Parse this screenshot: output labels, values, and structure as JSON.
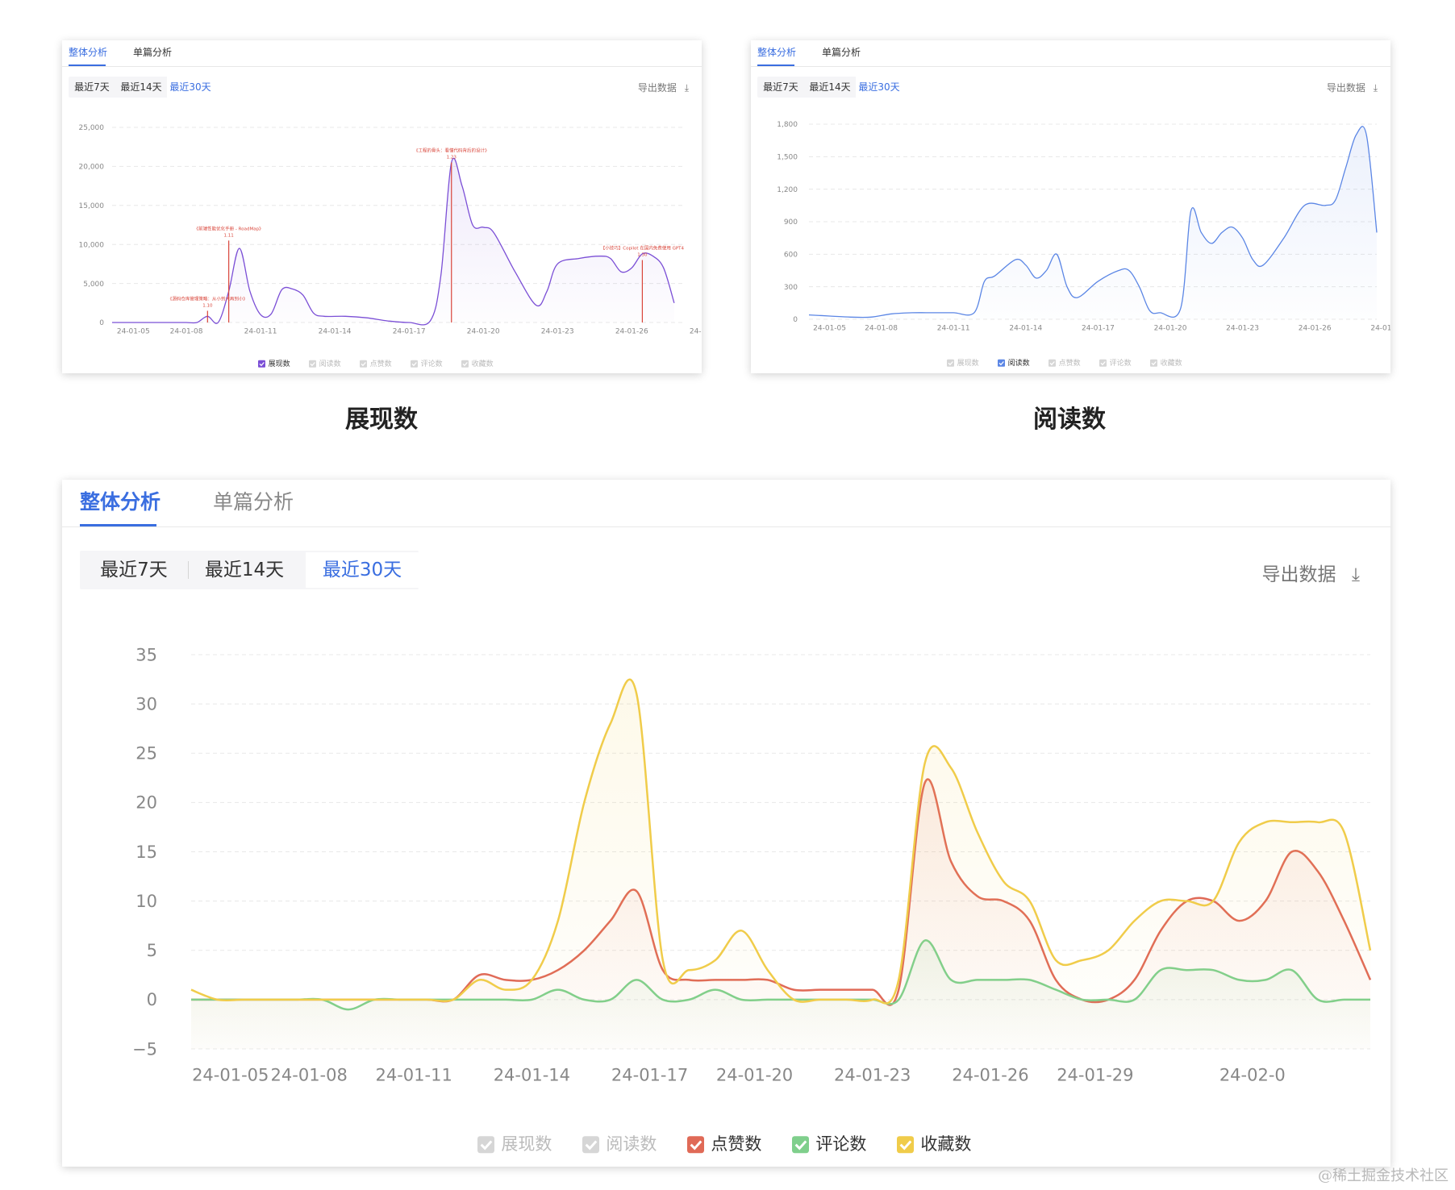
{
  "panels": [
    {
      "id": "impressions",
      "tabs": [
        "整体分析",
        "单篇分析"
      ],
      "ranges": [
        "最近7天",
        "最近14天",
        "最近30天"
      ],
      "active_range": 2,
      "export_label": "导出数据",
      "legend": [
        {
          "label": "展现数",
          "checked": true,
          "color": "#7b4fd6"
        },
        {
          "label": "阅读数",
          "checked": false,
          "color": "#cccccc"
        },
        {
          "label": "点赞数",
          "checked": false,
          "color": "#cccccc"
        },
        {
          "label": "评论数",
          "checked": false,
          "color": "#cccccc"
        },
        {
          "label": "收藏数",
          "checked": false,
          "color": "#cccccc"
        }
      ],
      "caption": "展现数"
    },
    {
      "id": "reads",
      "tabs": [
        "整体分析",
        "单篇分析"
      ],
      "ranges": [
        "最近7天",
        "最近14天",
        "最近30天"
      ],
      "active_range": 2,
      "export_label": "导出数据",
      "legend": [
        {
          "label": "展现数",
          "checked": false,
          "color": "#cccccc"
        },
        {
          "label": "阅读数",
          "checked": true,
          "color": "#5b86e5"
        },
        {
          "label": "点赞数",
          "checked": false,
          "color": "#cccccc"
        },
        {
          "label": "评论数",
          "checked": false,
          "color": "#cccccc"
        },
        {
          "label": "收藏数",
          "checked": false,
          "color": "#cccccc"
        }
      ],
      "caption": "阅读数"
    },
    {
      "id": "engagement",
      "tabs": [
        "整体分析",
        "单篇分析"
      ],
      "ranges": [
        "最近7天",
        "最近14天",
        "最近30天"
      ],
      "active_range": 2,
      "export_label": "导出数据",
      "legend": [
        {
          "label": "展现数",
          "checked": false,
          "color": "#cccccc"
        },
        {
          "label": "阅读数",
          "checked": false,
          "color": "#cccccc"
        },
        {
          "label": "点赞数",
          "checked": true,
          "color": "#e06a57"
        },
        {
          "label": "评论数",
          "checked": true,
          "color": "#7fcf8c"
        },
        {
          "label": "收藏数",
          "checked": true,
          "color": "#f0cc4a"
        }
      ]
    }
  ],
  "watermark": "@稀土掘金技术社区",
  "chart_data": [
    {
      "type": "line",
      "x_tick_labels": [
        "24-01-05",
        "24-01-08",
        "24-01-11",
        "24-01-14",
        "24-01-17",
        "24-01-20",
        "24-01-23",
        "24-01-26",
        "24-01-29",
        "24-02-0"
      ],
      "ylim": [
        0,
        25000
      ],
      "yticks": [
        "0",
        "5,000",
        "10,000",
        "15,000",
        "20,000",
        "25,000"
      ],
      "series": [
        {
          "name": "展现数",
          "color": "#7b4fd6",
          "points": [
            [
              0,
              0
            ],
            [
              0.5,
              0
            ],
            [
              1,
              0
            ],
            [
              1.5,
              0
            ],
            [
              2,
              0
            ],
            [
              2.5,
              0
            ],
            [
              3,
              0
            ],
            [
              3.5,
              0
            ],
            [
              4,
              0
            ],
            [
              4.5,
              800
            ],
            [
              5,
              0
            ],
            [
              5.5,
              4000
            ],
            [
              6,
              9500
            ],
            [
              6.5,
              4000
            ],
            [
              7,
              1000
            ],
            [
              7.5,
              1100
            ],
            [
              8,
              4200
            ],
            [
              8.5,
              4300
            ],
            [
              9,
              3500
            ],
            [
              9.5,
              1200
            ],
            [
              10,
              800
            ],
            [
              11,
              800
            ],
            [
              12,
              600
            ],
            [
              13,
              200
            ],
            [
              14,
              0
            ],
            [
              15,
              200
            ],
            [
              15.5,
              6000
            ],
            [
              16,
              20500
            ],
            [
              16.5,
              17500
            ],
            [
              17,
              12500
            ],
            [
              17.5,
              12200
            ],
            [
              18,
              11500
            ],
            [
              19,
              6500
            ],
            [
              20,
              2200
            ],
            [
              20.5,
              4000
            ],
            [
              21,
              7500
            ],
            [
              22,
              8200
            ],
            [
              23,
              8500
            ],
            [
              23.5,
              8200
            ],
            [
              24,
              6500
            ],
            [
              24.5,
              7000
            ],
            [
              25,
              8800
            ],
            [
              25.5,
              8500
            ],
            [
              26,
              7000
            ],
            [
              26.5,
              2500
            ]
          ]
        },
        {
          "name": "",
          "color": "#d9453a",
          "markers": [
            [
              4.5,
              1500,
              "1.10"
            ],
            [
              5.5,
              10500,
              "1.11"
            ],
            [
              16,
              20500,
              "1.23"
            ],
            [
              25,
              8000,
              "1.30"
            ]
          ]
        }
      ],
      "annotations": [
        {
          "text": "《源码仓库管理策略：从小到大再到小》",
          "date": "1.10"
        },
        {
          "text": "《前端性能优化手册 - RoadMap》",
          "date": "1.11"
        },
        {
          "text": "《工程的骨头：看懂代码背后的设计》",
          "date": "1.23"
        },
        {
          "text": "【小技巧】Copilot 在国内免费使用 GPT4",
          "date": "1.30"
        }
      ]
    },
    {
      "type": "area",
      "x_tick_labels": [
        "24-01-05",
        "24-01-08",
        "24-01-11",
        "24-01-14",
        "24-01-17",
        "24-01-20",
        "24-01-23",
        "24-01-26",
        "24-01-29",
        "24-02-0"
      ],
      "ylim": [
        0,
        1800
      ],
      "yticks": [
        "0",
        "300",
        "600",
        "900",
        "1,200",
        "1,500",
        "1,800"
      ],
      "series": [
        {
          "name": "阅读数",
          "color": "#5b86e5",
          "points": [
            [
              0,
              40
            ],
            [
              1,
              30
            ],
            [
              2,
              20
            ],
            [
              3,
              20
            ],
            [
              4,
              50
            ],
            [
              5,
              60
            ],
            [
              6,
              60
            ],
            [
              7,
              60
            ],
            [
              8,
              60
            ],
            [
              8.5,
              350
            ],
            [
              9,
              400
            ],
            [
              10,
              550
            ],
            [
              10.5,
              500
            ],
            [
              11,
              380
            ],
            [
              11.5,
              450
            ],
            [
              12,
              600
            ],
            [
              12.5,
              300
            ],
            [
              13,
              200
            ],
            [
              14,
              350
            ],
            [
              15,
              450
            ],
            [
              15.5,
              450
            ],
            [
              16,
              300
            ],
            [
              16.5,
              80
            ],
            [
              17,
              60
            ],
            [
              18,
              100
            ],
            [
              18.5,
              1000
            ],
            [
              19,
              800
            ],
            [
              19.5,
              700
            ],
            [
              20,
              800
            ],
            [
              20.5,
              850
            ],
            [
              21,
              750
            ],
            [
              21.5,
              550
            ],
            [
              22,
              500
            ],
            [
              23,
              750
            ],
            [
              24,
              1050
            ],
            [
              25,
              1050
            ],
            [
              25.5,
              1100
            ],
            [
              26,
              1400
            ],
            [
              26.5,
              1700
            ],
            [
              27,
              1700
            ],
            [
              27.5,
              800
            ]
          ]
        }
      ]
    },
    {
      "type": "area",
      "x_tick_labels": [
        "24-01-05",
        "24-01-08",
        "24-01-11",
        "24-01-14",
        "24-01-17",
        "24-01-20",
        "24-01-23",
        "24-01-26",
        "24-01-29",
        "24-02-0"
      ],
      "ylim": [
        -5,
        35
      ],
      "yticks": [
        "−5",
        "0",
        "5",
        "10",
        "15",
        "20",
        "25",
        "30",
        "35"
      ],
      "series": [
        {
          "name": "点赞数",
          "color": "#e06a57",
          "points": [
            [
              0,
              0
            ],
            [
              1,
              0
            ],
            [
              2,
              0
            ],
            [
              3,
              0
            ],
            [
              4,
              0
            ],
            [
              5,
              0
            ],
            [
              6,
              0
            ],
            [
              7,
              0
            ],
            [
              8,
              0
            ],
            [
              9,
              0
            ],
            [
              10,
              0
            ],
            [
              11,
              2.5
            ],
            [
              12,
              2
            ],
            [
              13,
              2
            ],
            [
              14,
              3
            ],
            [
              15,
              5
            ],
            [
              16,
              8
            ],
            [
              17,
              11
            ],
            [
              18,
              3
            ],
            [
              19,
              2
            ],
            [
              20,
              2
            ],
            [
              21,
              2
            ],
            [
              22,
              2
            ],
            [
              23,
              1
            ],
            [
              24,
              1
            ],
            [
              25,
              1
            ],
            [
              26,
              1
            ],
            [
              27,
              1
            ],
            [
              28,
              22
            ],
            [
              29,
              14
            ],
            [
              30,
              10.5
            ],
            [
              31,
              10
            ],
            [
              32,
              8
            ],
            [
              33,
              2
            ],
            [
              34,
              0
            ],
            [
              35,
              0
            ],
            [
              36,
              2
            ],
            [
              37,
              7
            ],
            [
              38,
              10
            ],
            [
              39,
              10
            ],
            [
              40,
              8
            ],
            [
              41,
              10
            ],
            [
              42,
              15
            ],
            [
              43,
              13
            ],
            [
              44,
              8
            ],
            [
              45,
              2
            ]
          ]
        },
        {
          "name": "评论数",
          "color": "#7fcf8c",
          "points": [
            [
              0,
              0
            ],
            [
              1,
              0
            ],
            [
              2,
              0
            ],
            [
              3,
              0
            ],
            [
              4,
              0
            ],
            [
              5,
              0
            ],
            [
              6,
              -1
            ],
            [
              7,
              0
            ],
            [
              8,
              0
            ],
            [
              9,
              0
            ],
            [
              10,
              0
            ],
            [
              11,
              0
            ],
            [
              12,
              0
            ],
            [
              13,
              0
            ],
            [
              14,
              1
            ],
            [
              15,
              0
            ],
            [
              16,
              0
            ],
            [
              17,
              2
            ],
            [
              18,
              0
            ],
            [
              19,
              0
            ],
            [
              20,
              1
            ],
            [
              21,
              0
            ],
            [
              22,
              0
            ],
            [
              23,
              0
            ],
            [
              24,
              0
            ],
            [
              25,
              0
            ],
            [
              26,
              0
            ],
            [
              27,
              0
            ],
            [
              28,
              6
            ],
            [
              29,
              2
            ],
            [
              30,
              2
            ],
            [
              31,
              2
            ],
            [
              32,
              2
            ],
            [
              33,
              1
            ],
            [
              34,
              0
            ],
            [
              35,
              0
            ],
            [
              36,
              0
            ],
            [
              37,
              3
            ],
            [
              38,
              3
            ],
            [
              39,
              3
            ],
            [
              40,
              2
            ],
            [
              41,
              2
            ],
            [
              42,
              3
            ],
            [
              43,
              0
            ],
            [
              44,
              0
            ],
            [
              45,
              0
            ]
          ]
        },
        {
          "name": "收藏数",
          "color": "#f0cc4a",
          "points": [
            [
              0,
              1
            ],
            [
              1,
              0
            ],
            [
              2,
              0
            ],
            [
              3,
              0
            ],
            [
              4,
              0
            ],
            [
              5,
              0
            ],
            [
              6,
              0
            ],
            [
              7,
              0
            ],
            [
              8,
              0
            ],
            [
              9,
              0
            ],
            [
              10,
              0
            ],
            [
              11,
              2
            ],
            [
              12,
              1
            ],
            [
              13,
              2
            ],
            [
              14,
              8
            ],
            [
              15,
              20
            ],
            [
              16,
              28
            ],
            [
              17,
              31
            ],
            [
              18,
              4
            ],
            [
              19,
              3
            ],
            [
              20,
              4
            ],
            [
              21,
              7
            ],
            [
              22,
              3
            ],
            [
              23,
              0
            ],
            [
              24,
              0
            ],
            [
              25,
              0
            ],
            [
              26,
              0
            ],
            [
              27,
              2
            ],
            [
              28,
              24
            ],
            [
              29,
              23.5
            ],
            [
              30,
              17
            ],
            [
              31,
              12
            ],
            [
              32,
              10
            ],
            [
              33,
              4
            ],
            [
              34,
              4
            ],
            [
              35,
              5
            ],
            [
              36,
              8
            ],
            [
              37,
              10
            ],
            [
              38,
              10
            ],
            [
              39,
              10
            ],
            [
              40,
              16
            ],
            [
              41,
              18
            ],
            [
              42,
              18
            ],
            [
              43,
              18
            ],
            [
              44,
              17
            ],
            [
              45,
              5
            ]
          ]
        }
      ]
    }
  ]
}
